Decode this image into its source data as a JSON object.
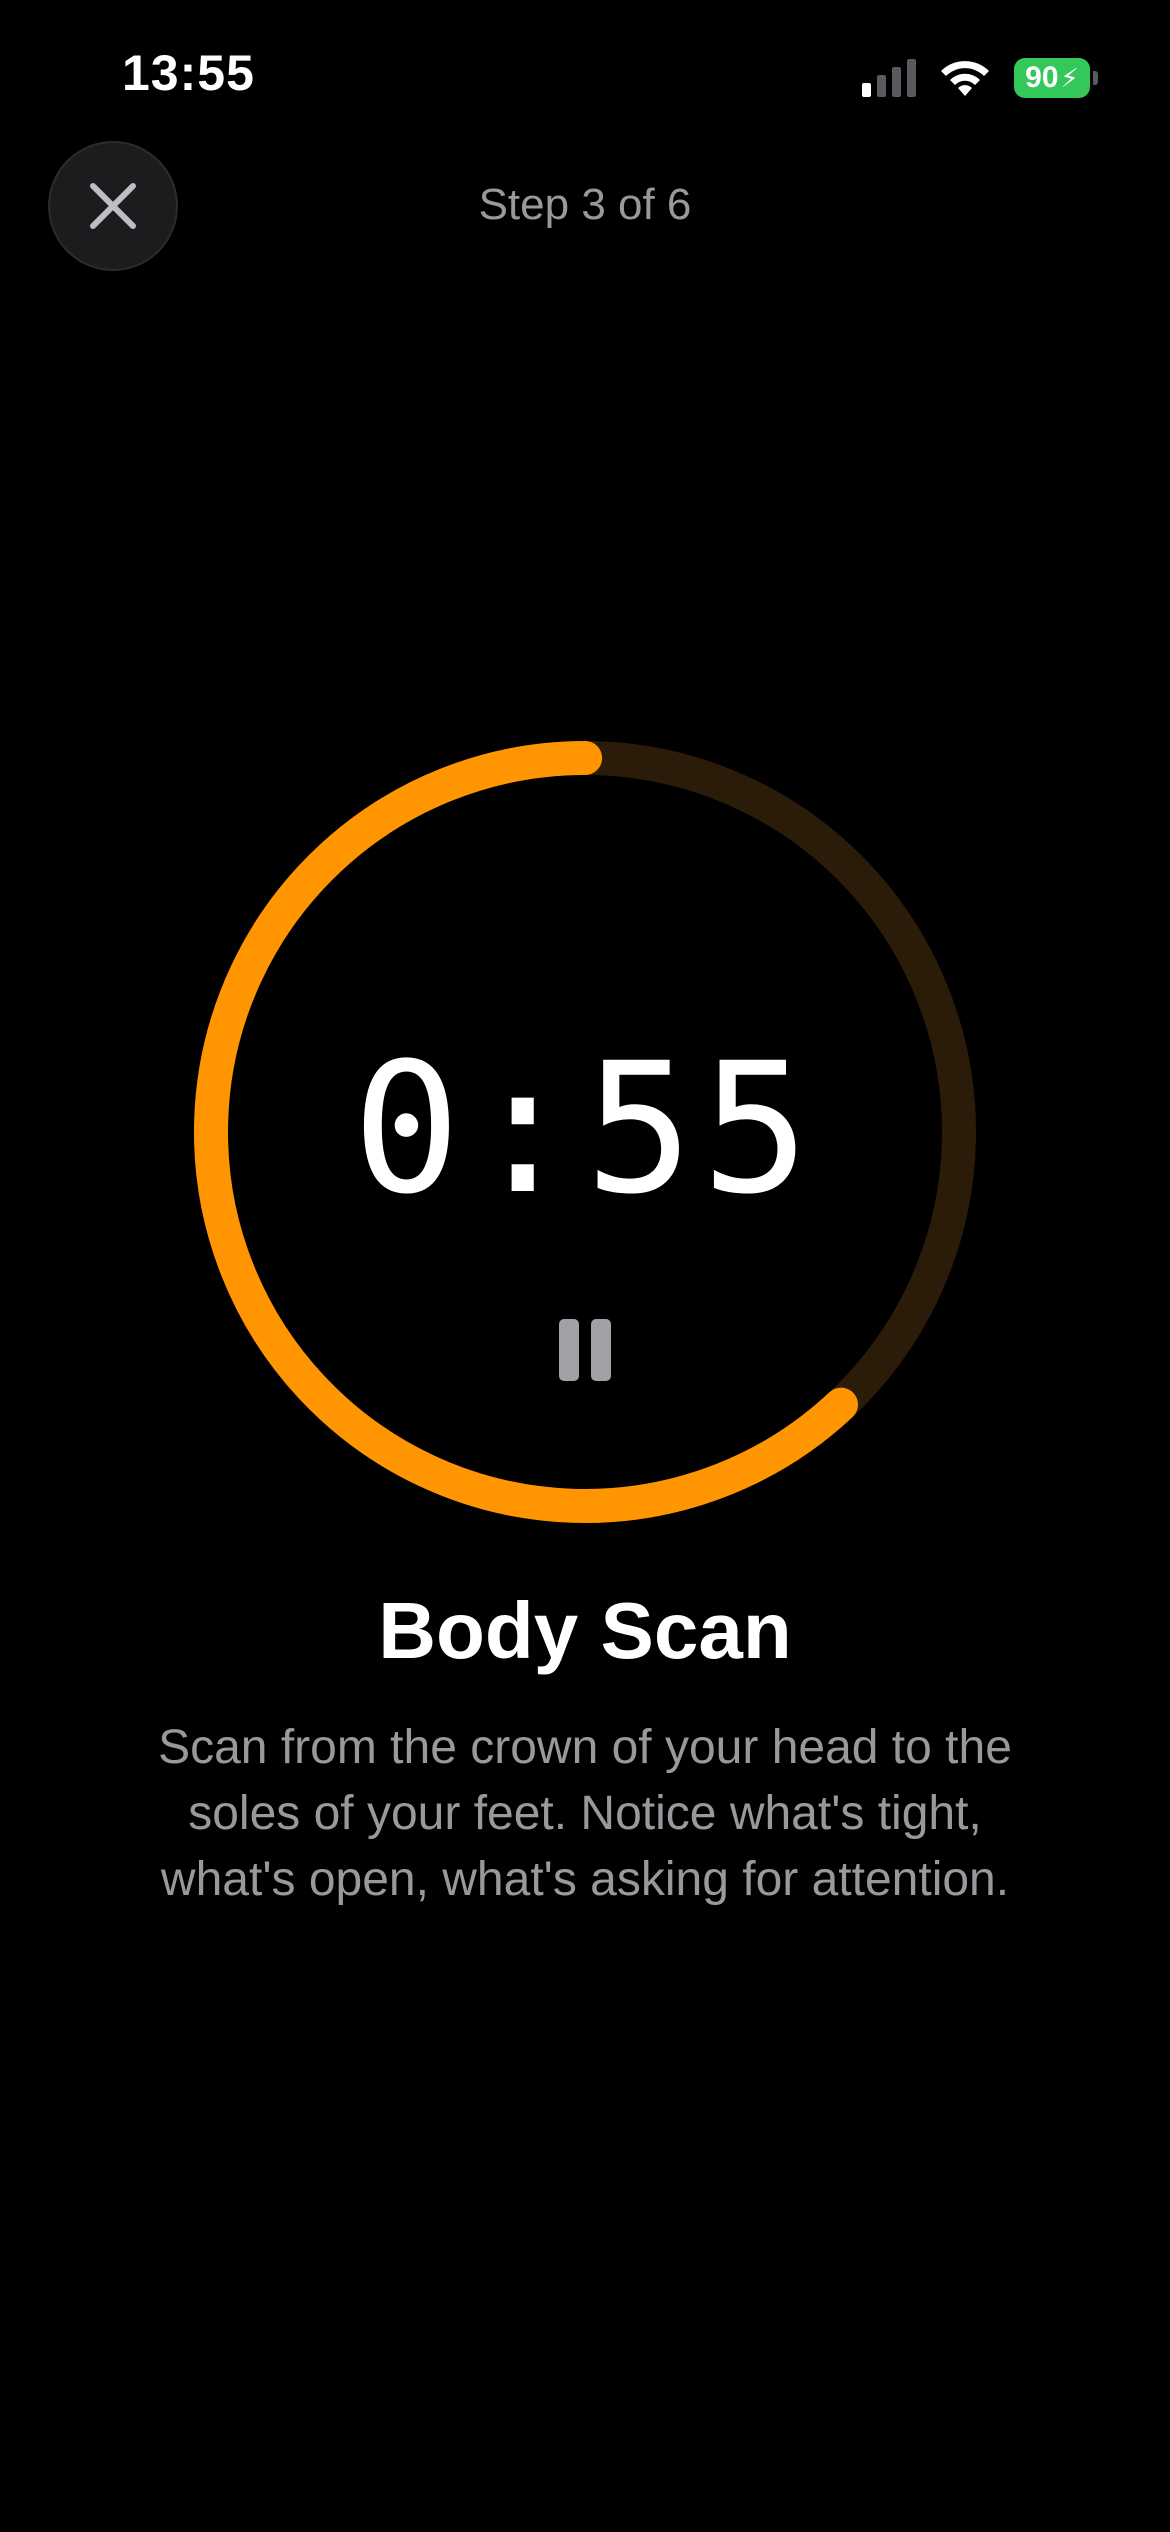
{
  "status_bar": {
    "time": "13:55",
    "battery_level": "90",
    "battery_color": "#34c759",
    "icons": [
      "cellular-signal-icon",
      "wifi-icon",
      "battery-charging-icon"
    ]
  },
  "header": {
    "close_icon": "close-icon",
    "step_label": "Step 3 of 6"
  },
  "timer": {
    "display": "0:55",
    "progress_fraction": 0.62,
    "ring_color": "#ff9500",
    "ring_track_color": "#2a1c08",
    "pause_icon": "pause-icon"
  },
  "content": {
    "title": "Body Scan",
    "description": "Scan from the crown of your head to the soles of your feet. Notice what's tight, what's open, what's asking for attention."
  }
}
